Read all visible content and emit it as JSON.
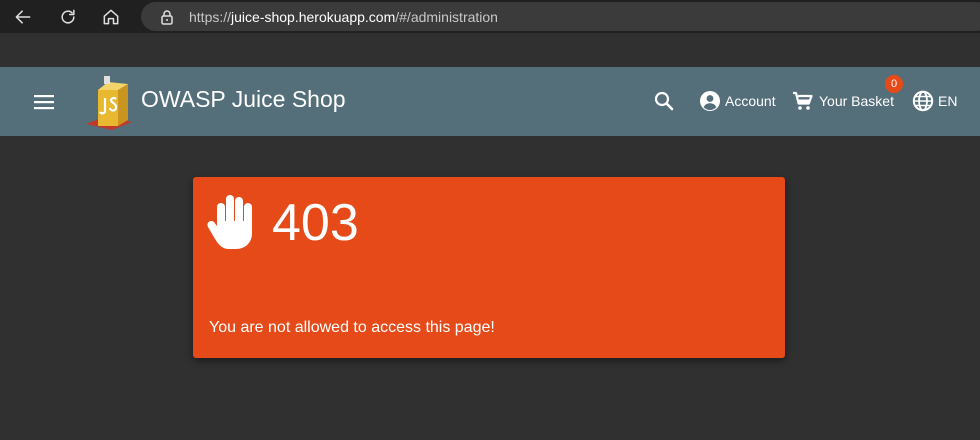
{
  "browser": {
    "url_scheme": "https://",
    "url_host": "juice-shop.herokuapp.com",
    "url_path": "/#/administration"
  },
  "toolbar": {
    "title": "OWASP Juice Shop",
    "account_label": "Account",
    "basket_label": "Your Basket",
    "basket_count": "0",
    "language_label": "EN"
  },
  "error": {
    "code": "403",
    "message": "You are not allowed to access this page!"
  },
  "colors": {
    "toolbar": "#546e7a",
    "card": "#e64a19",
    "background": "#303030"
  },
  "icons": [
    "back-icon",
    "reload-icon",
    "home-icon",
    "lock-icon",
    "menu-icon",
    "search-icon",
    "account-circle-icon",
    "cart-icon",
    "language-icon",
    "hand-icon"
  ]
}
